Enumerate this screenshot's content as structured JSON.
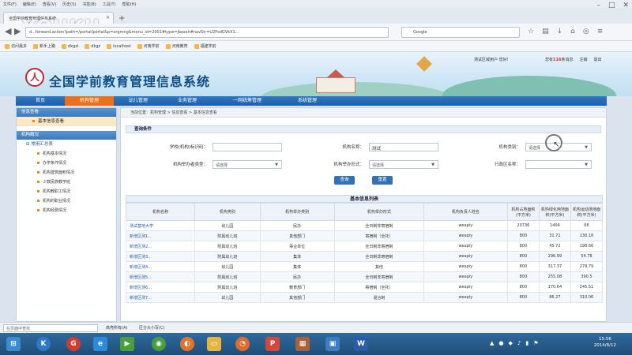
{
  "browser": {
    "menu": [
      "文件(F)",
      "编辑(E)",
      "查看(V)",
      "历史(S)",
      "书签(B)",
      "工具(T)",
      "帮助(H)"
    ],
    "tab_title": "全国学前教育管理信息系统",
    "url": "d...forward.action?path=/portal/portal&p=orgmng&menu_id=2001#type=jboxsh#navStr=U2FsdGVkX1...",
    "search_text": "Google",
    "search_logo": "G",
    "watermark": "YOUKU",
    "bookmarks": [
      "访问最多",
      "新手上路",
      "dkgzl",
      "dkgz",
      "localhost",
      "河南学前",
      "河南教育",
      "福建学前"
    ]
  },
  "header": {
    "logo_glyph": "人",
    "title": "全国学前教育管理信息系统",
    "user_text": "测试区域用户  您好!",
    "msg_prefix": "您有",
    "msg_count": "116",
    "msg_suffix": "条消息",
    "logout": "注销",
    "exit": "退出"
  },
  "nav": {
    "items": [
      "首页",
      "机构管理",
      "幼儿管理",
      "业务管理",
      "一网统筹管理",
      "系统管理"
    ]
  },
  "sidebar": {
    "head1": "信息查看",
    "item1": "基本信息查看",
    "head2": "机构概况",
    "group": "常用汇总表",
    "subs": [
      "机构基本情况",
      "办学条件情况",
      "机构建筑面积情况",
      "少数民族教学班",
      "机构教职工情况",
      "机构的职业情况",
      "机构经费情况"
    ]
  },
  "main": {
    "breadcrumb": "当前位置：机构管理 > 信息查看 > 基本信息查看",
    "query_title": "查询条件",
    "labels": {
      "school_code": "学校(机构)标识码：",
      "org_name": "机构名称：",
      "org_type": "机构类别：",
      "run_type": "机构举办者类型：",
      "run_form": "机构举办形式：",
      "region": "行政区名称："
    },
    "org_name_value": "测试",
    "select_placeholder": "请选择",
    "query_button": "查询",
    "reset_button": "重置",
    "table_caption": "基本信息列表"
  },
  "table": {
    "headers": [
      "机构名称",
      "机构类别",
      "机构举办类别",
      "机构举办形式",
      "机构负责人姓名",
      "机构占地面积(平方米)",
      "机构绿化用地面积(平方米)",
      "机构运动场地面积(平方米)"
    ],
    "rows": [
      [
        "测试基地大学",
        "幼儿园",
        "民办",
        "全日制非寄宿制",
        "weapiy",
        "20736",
        "1404",
        "66"
      ],
      [
        "新增区测1...",
        "附属幼儿班",
        "其他部门",
        "寄宿制（全托）",
        "weapiy",
        "800",
        "31.71",
        "130.18"
      ],
      [
        "新增区测2...",
        "附属幼儿班",
        "事业单位",
        "全日制非寄宿制",
        "weapiy",
        "800",
        "45.72",
        "198.66"
      ],
      [
        "新增区测3...",
        "附属幼儿班",
        "集体",
        "全日制非寄宿制",
        "weapiy",
        "800",
        "296.99",
        "54.78"
      ],
      [
        "新增区测4...",
        "幼儿园",
        "集体",
        "其他",
        "weapiy",
        "800",
        "317.37",
        "279.79"
      ],
      [
        "新增区测5...",
        "附属幼儿班",
        "民办",
        "全日制非寄宿制",
        "weapiy",
        "800",
        "255.08",
        "390.5"
      ],
      [
        "新增区测6...",
        "附属幼儿班",
        "教育部门",
        "寄宿制（全托）",
        "weapiy",
        "800",
        "170.64",
        "245.51"
      ],
      [
        "新增区测7...",
        "幼儿园",
        "其他部门",
        "混合制",
        "weapiy",
        "800",
        "86.27",
        "310.06"
      ]
    ]
  },
  "status": {
    "find_placeholder": "在页面中查找",
    "highlight": "高亮所有(A)",
    "match_case": "区分大小写(C)"
  },
  "taskbar": {
    "time": "15:56",
    "date": "2014/8/12"
  }
}
